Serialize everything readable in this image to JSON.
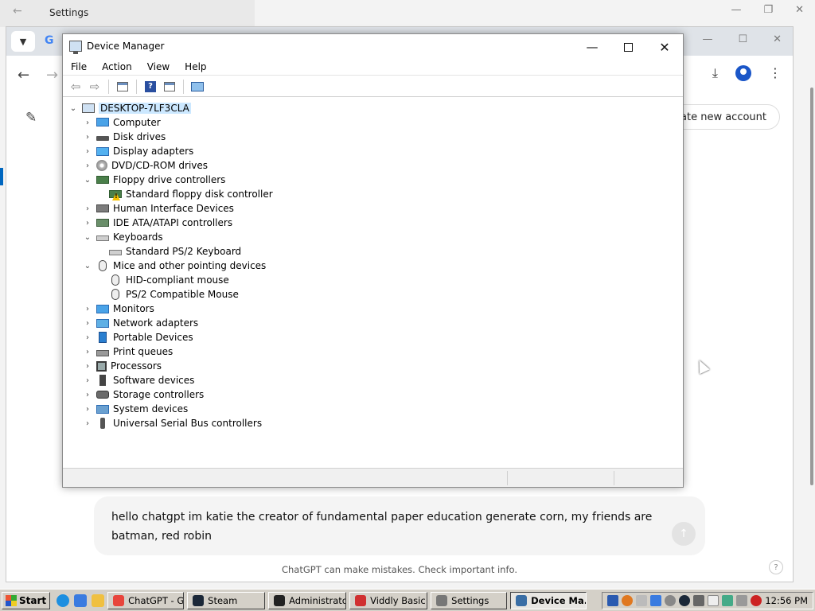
{
  "settings_window": {
    "title": "Settings"
  },
  "browser": {
    "create_account_label": "eate new account",
    "chat_input": {
      "value_line1": "hello chatgpt im katie the creator of fundamental paper education generate corn, my friends are",
      "value_line2": "batman, red robin"
    },
    "disclaimer": "ChatGPT can make mistakes. Check important info.",
    "help_label": "?"
  },
  "device_manager": {
    "title": "Device Manager",
    "menu": [
      "File",
      "Action",
      "View",
      "Help"
    ],
    "root": "DESKTOP-7LF3CLA",
    "tree": [
      {
        "label": "Computer",
        "icon": "computer-icon",
        "expanded": false
      },
      {
        "label": "Disk drives",
        "icon": "disk-drive-icon",
        "expanded": false
      },
      {
        "label": "Display adapters",
        "icon": "display-adapter-icon",
        "expanded": false
      },
      {
        "label": "DVD/CD-ROM drives",
        "icon": "dvd-drive-icon",
        "expanded": false
      },
      {
        "label": "Floppy drive controllers",
        "icon": "floppy-controller-icon",
        "expanded": true
      },
      {
        "label": "Standard floppy disk controller",
        "icon": "floppy-warning-icon",
        "child": true
      },
      {
        "label": "Human Interface Devices",
        "icon": "hid-icon",
        "expanded": false
      },
      {
        "label": "IDE ATA/ATAPI controllers",
        "icon": "ide-controller-icon",
        "expanded": false
      },
      {
        "label": "Keyboards",
        "icon": "keyboard-icon",
        "expanded": true
      },
      {
        "label": "Standard PS/2 Keyboard",
        "icon": "keyboard-icon",
        "child": true
      },
      {
        "label": "Mice and other pointing devices",
        "icon": "mouse-icon",
        "expanded": true
      },
      {
        "label": "HID-compliant mouse",
        "icon": "mouse-icon",
        "child": true
      },
      {
        "label": "PS/2 Compatible Mouse",
        "icon": "mouse-icon",
        "child": true
      },
      {
        "label": "Monitors",
        "icon": "monitor-icon",
        "expanded": false
      },
      {
        "label": "Network adapters",
        "icon": "network-adapter-icon",
        "expanded": false
      },
      {
        "label": "Portable Devices",
        "icon": "portable-device-icon",
        "expanded": false
      },
      {
        "label": "Print queues",
        "icon": "printer-icon",
        "expanded": false
      },
      {
        "label": "Processors",
        "icon": "processor-icon",
        "expanded": false
      },
      {
        "label": "Software devices",
        "icon": "software-device-icon",
        "expanded": false
      },
      {
        "label": "Storage controllers",
        "icon": "storage-controller-icon",
        "expanded": false
      },
      {
        "label": "System devices",
        "icon": "system-device-icon",
        "expanded": false
      },
      {
        "label": "Universal Serial Bus controllers",
        "icon": "usb-icon",
        "expanded": false
      }
    ]
  },
  "taskbar": {
    "start_label": "Start",
    "tasks": [
      {
        "label": "ChatGPT - G...",
        "icon": "chrome-icon",
        "color": "#e8453c"
      },
      {
        "label": "Steam",
        "icon": "steam-icon",
        "color": "#1b2838"
      },
      {
        "label": "Administrator:...",
        "icon": "cmd-icon",
        "color": "#222222"
      },
      {
        "label": "Viddly Basic",
        "icon": "viddly-icon",
        "color": "#d03030"
      },
      {
        "label": "Settings",
        "icon": "settings-gear-icon",
        "color": "#777777"
      },
      {
        "label": "Device Ma...",
        "icon": "device-manager-icon",
        "color": "#3a6ea5",
        "active": true
      }
    ],
    "clock": "12:56 PM"
  }
}
